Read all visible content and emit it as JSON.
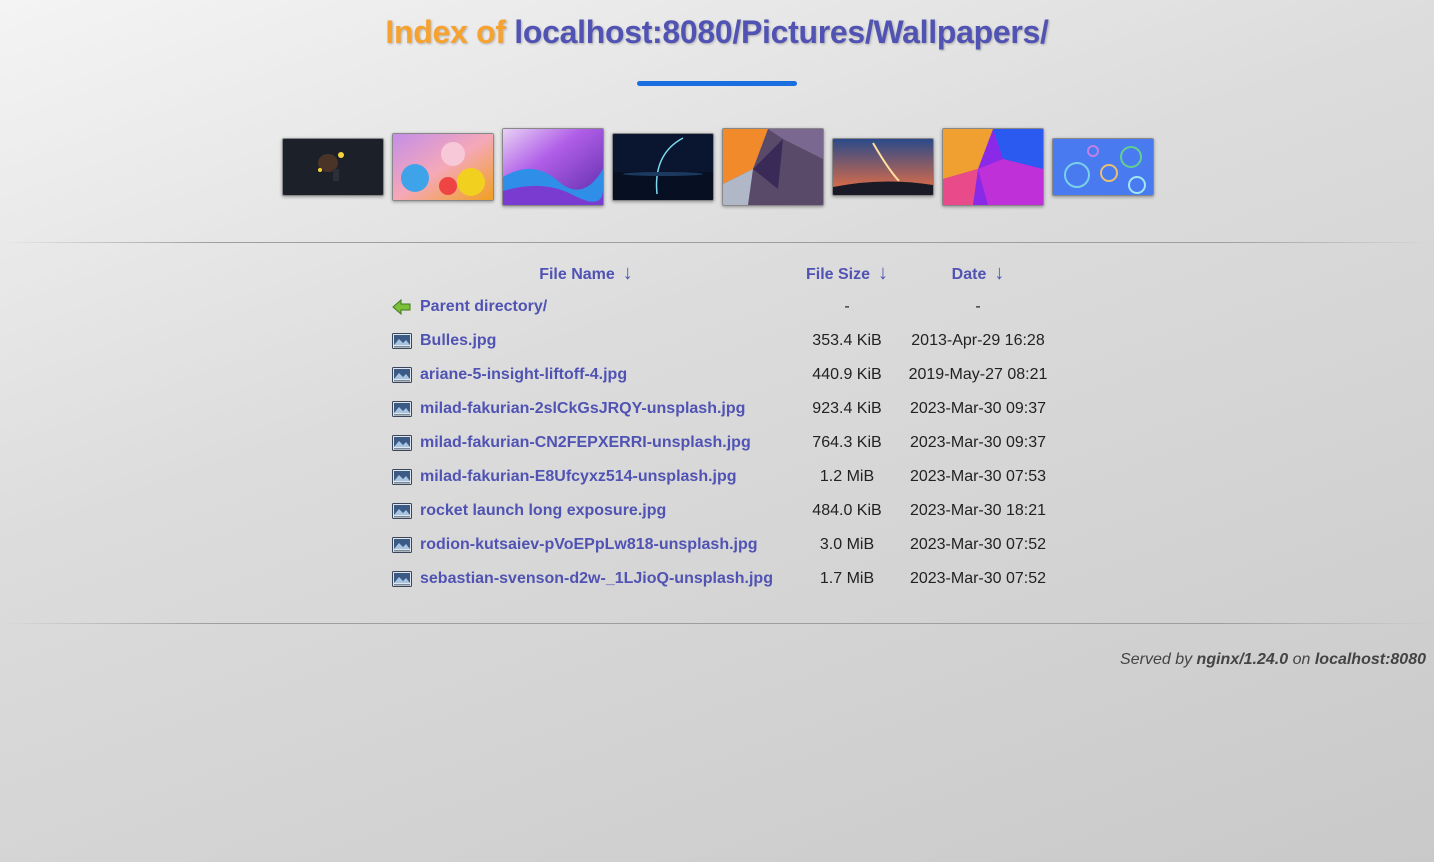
{
  "title": {
    "prefix": "Index of",
    "path": "localhost:8080/Pictures/Wallpapers/"
  },
  "thumbnails": [
    {
      "name": "thumbnail-dark-figures"
    },
    {
      "name": "thumbnail-colorful-drops"
    },
    {
      "name": "thumbnail-purple-waves"
    },
    {
      "name": "thumbnail-dark-arc"
    },
    {
      "name": "thumbnail-abstract-shapes"
    },
    {
      "name": "thumbnail-rocket-launch"
    },
    {
      "name": "thumbnail-abstract-colors"
    },
    {
      "name": "thumbnail-bubbles"
    }
  ],
  "table": {
    "headers": {
      "name": "File Name",
      "size": "File Size",
      "date": "Date",
      "sort_arrow": "↓"
    },
    "rows": [
      {
        "name": "Parent directory/",
        "size": "-",
        "date": "-",
        "icon": "back-arrow-icon"
      },
      {
        "name": "Bulles.jpg",
        "size": "353.4 KiB",
        "date": "2013-Apr-29 16:28",
        "icon": "image-file-icon"
      },
      {
        "name": "ariane-5-insight-liftoff-4.jpg",
        "size": "440.9 KiB",
        "date": "2019-May-27 08:21",
        "icon": "image-file-icon"
      },
      {
        "name": "milad-fakurian-2slCkGsJRQY-unsplash.jpg",
        "size": "923.4 KiB",
        "date": "2023-Mar-30 09:37",
        "icon": "image-file-icon"
      },
      {
        "name": "milad-fakurian-CN2FEPXERRI-unsplash.jpg",
        "size": "764.3 KiB",
        "date": "2023-Mar-30 09:37",
        "icon": "image-file-icon"
      },
      {
        "name": "milad-fakurian-E8Ufcyxz514-unsplash.jpg",
        "size": "1.2 MiB",
        "date": "2023-Mar-30 07:53",
        "icon": "image-file-icon"
      },
      {
        "name": "rocket launch long exposure.jpg",
        "size": "484.0 KiB",
        "date": "2023-Mar-30 18:21",
        "icon": "image-file-icon"
      },
      {
        "name": "rodion-kutsaiev-pVoEPpLw818-unsplash.jpg",
        "size": "3.0 MiB",
        "date": "2023-Mar-30 07:52",
        "icon": "image-file-icon"
      },
      {
        "name": "sebastian-svenson-d2w-_1LJioQ-unsplash.jpg",
        "size": "1.7 MiB",
        "date": "2023-Mar-30 07:52",
        "icon": "image-file-icon"
      }
    ]
  },
  "footer": {
    "served_by": "Served by",
    "server": "nginx/1.24.0",
    "on": "on",
    "host": "localhost:8080"
  },
  "colors": {
    "title_prefix": "#f7a12f",
    "link": "#5053b3",
    "accent_bar": "#1a6fe0"
  }
}
